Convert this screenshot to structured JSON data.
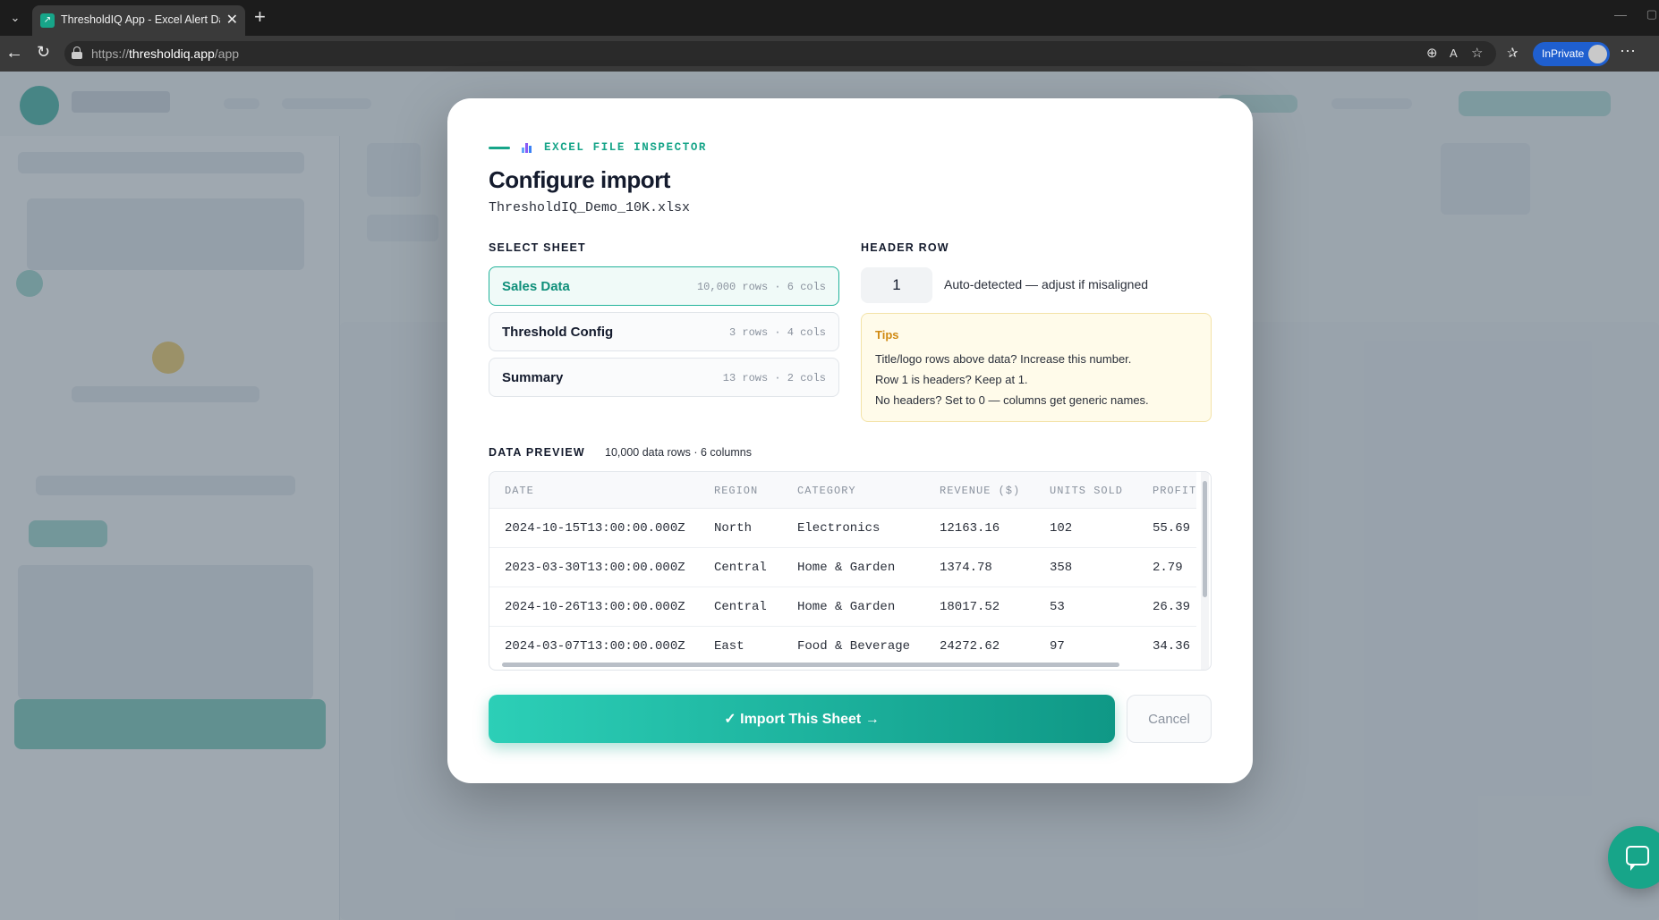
{
  "browser": {
    "tab_title": "ThresholdIQ App - Excel Alert Dashboard",
    "url_prefix": "https://",
    "url_host": "thresholdiq.app",
    "url_path": "/app",
    "inprivate_label": "InPrivate",
    "new_tab_glyph": "+",
    "close_glyph": "✕",
    "back_glyph": "←",
    "reload_glyph": "↻",
    "menu_glyph": "···"
  },
  "modal": {
    "eyebrow": "EXCEL FILE INSPECTOR",
    "title": "Configure import",
    "file_name": "ThresholdIQ_Demo_10K.xlsx",
    "select_sheet_label": "SELECT SHEET",
    "sheets": [
      {
        "name": "Sales Data",
        "meta": "10,000 rows · 6 cols",
        "selected": true
      },
      {
        "name": "Threshold Config",
        "meta": "3 rows · 4 cols",
        "selected": false
      },
      {
        "name": "Summary",
        "meta": "13 rows · 2 cols",
        "selected": false
      }
    ],
    "header_row_label": "HEADER ROW",
    "header_row_value": "1",
    "header_row_hint": "Auto-detected — adjust if misaligned",
    "tips": {
      "title": "Tips",
      "lines": [
        "Title/logo rows above data? Increase this number.",
        "Row 1 is headers? Keep at 1.",
        "No headers? Set to 0 — columns get generic names."
      ]
    },
    "preview_label": "DATA PREVIEW",
    "preview_stats": "10,000 data rows · 6 columns",
    "preview": {
      "columns": [
        "DATE",
        "REGION",
        "CATEGORY",
        "REVENUE ($)",
        "UNITS SOLD",
        "PROFIT"
      ],
      "rows": [
        [
          "2024-10-15T13:00:00.000Z",
          "North",
          "Electronics",
          "12163.16",
          "102",
          "55.69"
        ],
        [
          "2023-03-30T13:00:00.000Z",
          "Central",
          "Home & Garden",
          "1374.78",
          "358",
          "2.79"
        ],
        [
          "2024-10-26T13:00:00.000Z",
          "Central",
          "Home & Garden",
          "18017.52",
          "53",
          "26.39"
        ],
        [
          "2024-03-07T13:00:00.000Z",
          "East",
          "Food & Beverage",
          "24272.62",
          "97",
          "34.36"
        ]
      ]
    },
    "import_button": "✓ Import This Sheet →",
    "cancel_button": "Cancel"
  },
  "colors": {
    "accent": "#17a589",
    "tips_title": "#d08a12",
    "tips_bg": "#fffbea",
    "inprivate": "#1f5fcf"
  },
  "icons": {
    "eyebrow": "bar-chart-icon",
    "chat": "chat-bubble-icon",
    "lock": "lock-icon"
  }
}
